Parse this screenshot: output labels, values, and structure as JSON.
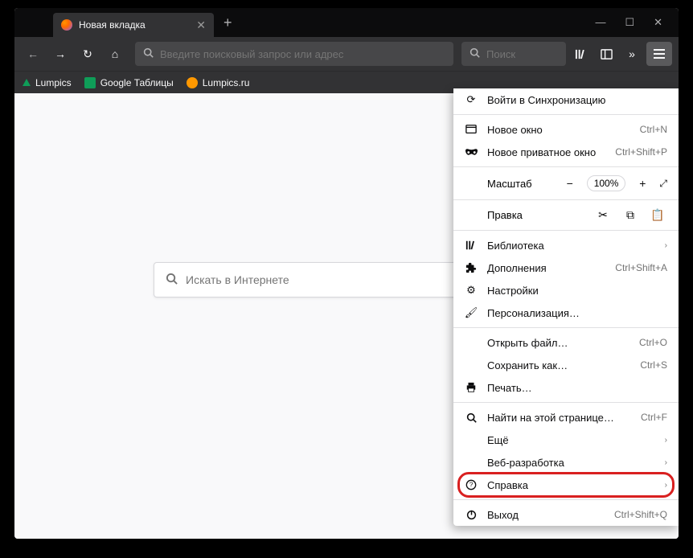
{
  "tab": {
    "title": "Новая вкладка"
  },
  "urlbar": {
    "placeholder": "Введите поисковый запрос или адрес"
  },
  "searchbox": {
    "placeholder": "Поиск"
  },
  "bookmarks": {
    "lumpics": "Lumpics",
    "sheets": "Google Таблицы",
    "lumpicsru": "Lumpics.ru"
  },
  "center_search": {
    "placeholder": "Искать в Интернете"
  },
  "menu": {
    "sync": "Войти в Синхронизацию",
    "new_window": {
      "label": "Новое окно",
      "shortcut": "Ctrl+N"
    },
    "new_private": {
      "label": "Новое приватное окно",
      "shortcut": "Ctrl+Shift+P"
    },
    "zoom": {
      "label": "Масштаб",
      "value": "100%"
    },
    "edit": {
      "label": "Правка"
    },
    "library": "Библиотека",
    "addons": {
      "label": "Дополнения",
      "shortcut": "Ctrl+Shift+A"
    },
    "settings": "Настройки",
    "customize": "Персонализация…",
    "open_file": {
      "label": "Открыть файл…",
      "shortcut": "Ctrl+O"
    },
    "save_as": {
      "label": "Сохранить как…",
      "shortcut": "Ctrl+S"
    },
    "print": "Печать…",
    "find": {
      "label": "Найти на этой странице…",
      "shortcut": "Ctrl+F"
    },
    "more": "Ещё",
    "dev": "Веб-разработка",
    "help": "Справка",
    "quit": {
      "label": "Выход",
      "shortcut": "Ctrl+Shift+Q"
    }
  }
}
